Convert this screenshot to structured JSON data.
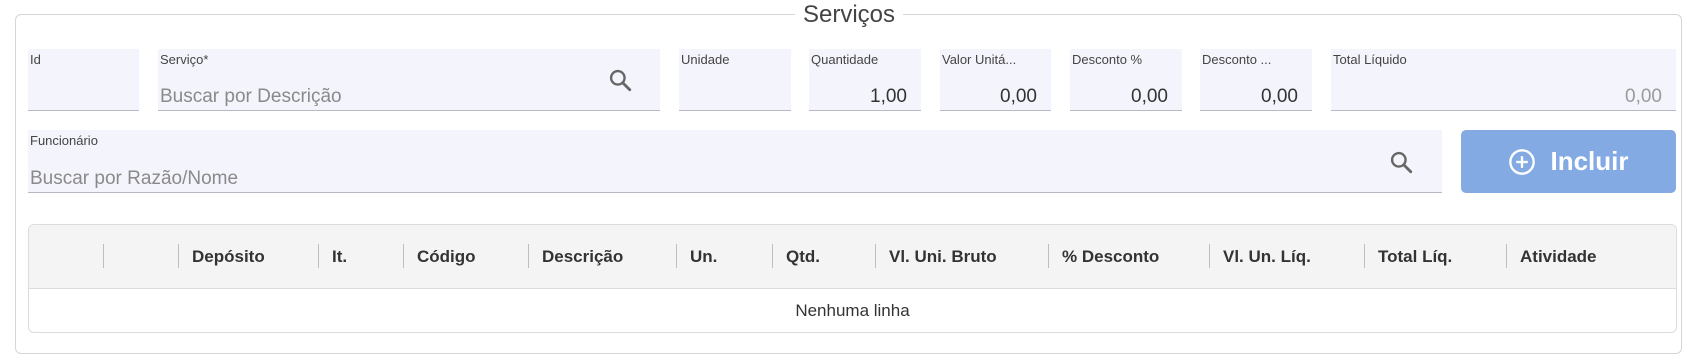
{
  "section": {
    "title": "Serviços"
  },
  "fields": {
    "id": {
      "label": "Id",
      "value": ""
    },
    "servico": {
      "label": "Serviço*",
      "placeholder": "Buscar por Descrição"
    },
    "unidade": {
      "label": "Unidade",
      "value": ""
    },
    "quantidade": {
      "label": "Quantidade",
      "value": "1,00"
    },
    "valor_unitario": {
      "label": "Valor Unitá...",
      "value": "0,00"
    },
    "desconto_pct": {
      "label": "Desconto %",
      "value": "0,00"
    },
    "desconto_valor": {
      "label": "Desconto ...",
      "value": "0,00"
    },
    "total_liquido": {
      "label": "Total Líquido",
      "value": "0,00"
    },
    "funcionario": {
      "label": "Funcionário",
      "placeholder": "Buscar por Razão/Nome"
    }
  },
  "actions": {
    "incluir_label": "Incluir",
    "icon": "plus-circle-icon"
  },
  "table": {
    "columns": [
      "Depósito",
      "It.",
      "Código",
      "Descrição",
      "Un.",
      "Qtd.",
      "Vl. Uni. Bruto",
      "% Desconto",
      "Vl. Un. Líq.",
      "Total Líq.",
      "Atividade"
    ],
    "empty_message": "Nenhuma linha"
  },
  "colors": {
    "accent_button": "#84aae3",
    "field_bg": "#f4f4fc"
  }
}
